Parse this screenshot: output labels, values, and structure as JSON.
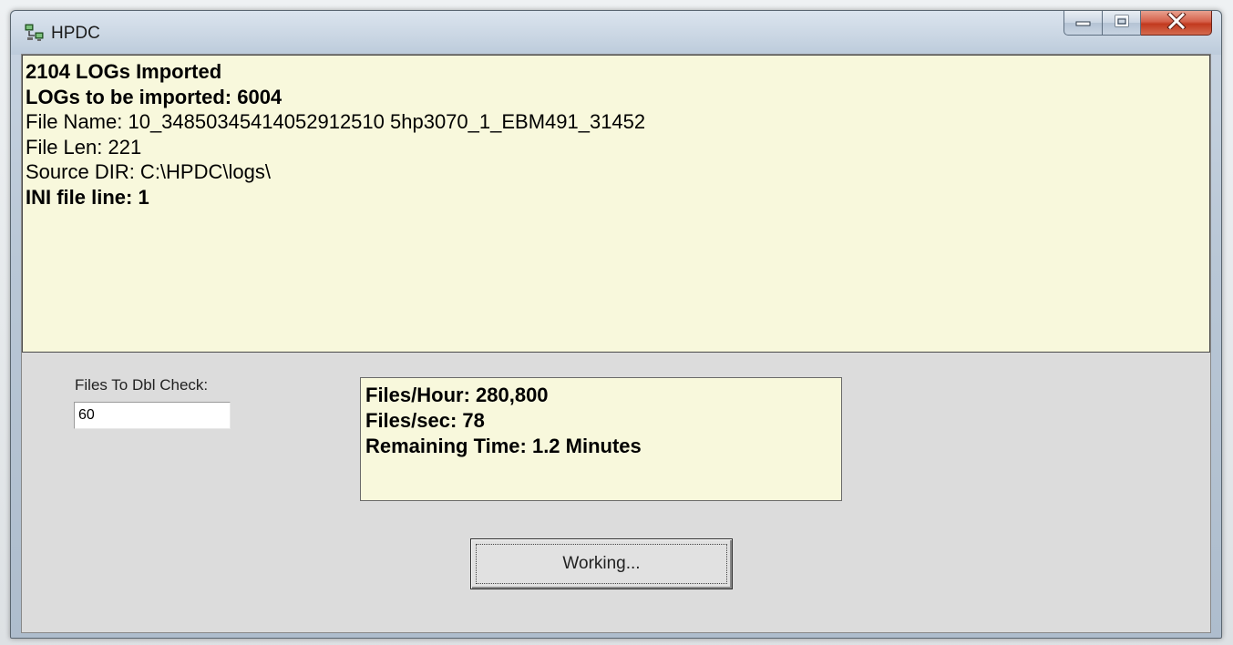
{
  "window": {
    "title": "HPDC",
    "icon": "network-computers-icon",
    "caption_buttons": [
      "minimize-icon",
      "maximize-icon",
      "close-icon"
    ],
    "close_color": "#c8422a"
  },
  "log": {
    "lines": [
      "2104  LOGs Imported",
      "LOGs to be imported: 6004",
      "File Name: 10_34850345414052912510 5hp3070_1_EBM491_31452",
      "File Len: 221",
      "Source DIR: C:\\HPDC\\logs\\",
      "INI file line: 1"
    ],
    "background": "#f8f8dc"
  },
  "dbl_check": {
    "label": "Files To Dbl Check:",
    "value": "60"
  },
  "stats": {
    "files_per_hour": "Files/Hour: 280,800",
    "files_per_sec": "Files/sec: 78",
    "remaining_time": "Remaining Time: 1.2 Minutes"
  },
  "action_button": {
    "label": "Working..."
  }
}
